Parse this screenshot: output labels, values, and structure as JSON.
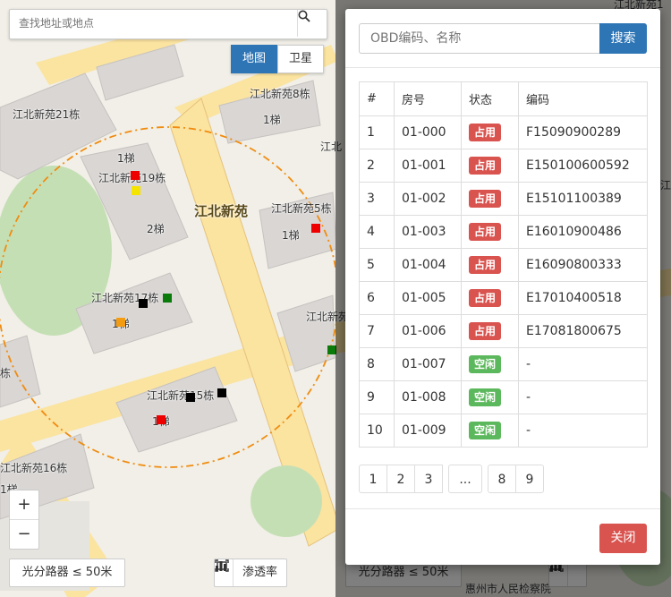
{
  "map": {
    "search_placeholder": "查找地址或地点",
    "maptype": {
      "map": "地图",
      "satellite": "卫星"
    },
    "zoom_in": "+",
    "zoom_out": "−",
    "scale_filter": "光分路器 ≤ 50米",
    "penetration_label": "渗透率",
    "labels": {
      "b21": "江北新苑21栋",
      "b8": "江北新苑8栋",
      "b8u": "1梯",
      "b19u1": "1梯",
      "b19": "江北新苑19栋",
      "b19u2": "2梯",
      "area": "江北新苑",
      "b5": "江北新苑5栋",
      "b5u": "1梯",
      "b17": "江北新苑17栋",
      "b17u": "1梯",
      "b15": "江北新苑15栋",
      "b15u": "1梯",
      "b16": "江北新苑16栋",
      "b16u": "1梯",
      "edge1": "江北",
      "edge2": "江北新苑1",
      "edge3": "栋",
      "edge4": "江北新苑1",
      "edge5": "江北新苑",
      "edge6": "江北",
      "bg_scale": "光分路器 ≤ 50米",
      "bg_court": "惠州市人民检察院"
    }
  },
  "modal": {
    "search_placeholder": "OBD编码、名称",
    "search_button": "搜索",
    "columns": [
      "#",
      "房号",
      "状态",
      "编码"
    ],
    "rows": [
      {
        "no": "1",
        "room": "01-000",
        "status": "占用",
        "code": "F15090900289"
      },
      {
        "no": "2",
        "room": "01-001",
        "status": "占用",
        "code": "E150100600592"
      },
      {
        "no": "3",
        "room": "01-002",
        "status": "占用",
        "code": "E15101100389"
      },
      {
        "no": "4",
        "room": "01-003",
        "status": "占用",
        "code": "E16010900486"
      },
      {
        "no": "5",
        "room": "01-004",
        "status": "占用",
        "code": "E16090800333"
      },
      {
        "no": "6",
        "room": "01-005",
        "status": "占用",
        "code": "E17010400518"
      },
      {
        "no": "7",
        "room": "01-006",
        "status": "占用",
        "code": "E17081800675"
      },
      {
        "no": "8",
        "room": "01-007",
        "status": "空闲",
        "code": "-"
      },
      {
        "no": "9",
        "room": "01-008",
        "status": "空闲",
        "code": "-"
      },
      {
        "no": "10",
        "room": "01-009",
        "status": "空闲",
        "code": "-"
      }
    ],
    "pages": [
      "1",
      "2",
      "3",
      "...",
      "8",
      "9"
    ],
    "close_button": "关闭"
  },
  "colors": {
    "occupied": "#d9534f",
    "free": "#5cb85c",
    "primary": "#2e75b6"
  },
  "icons": {
    "search": "magnifier",
    "screenshot": "frame-icon",
    "chart": "bar-chart"
  }
}
